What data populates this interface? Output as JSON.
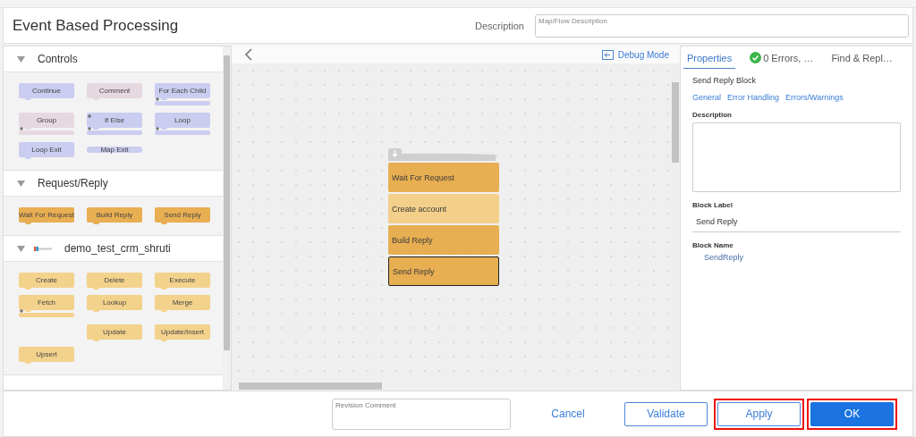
{
  "window": {
    "title": "Event Based Processing"
  },
  "description": {
    "label": "Description",
    "placeholder": "Map/Flow Description"
  },
  "palette": {
    "sections": [
      {
        "title": "Controls",
        "expanded": true,
        "icon": false,
        "blocks": [
          {
            "label": "Continue",
            "kind": "simple",
            "color": "#cacdef"
          },
          {
            "label": "Comment",
            "kind": "simple",
            "color": "#e6d8e0"
          },
          {
            "label": "For Each Child",
            "kind": "container",
            "color": "#cacdef"
          },
          {
            "label": "Group",
            "kind": "container",
            "color": "#e6d8e0"
          },
          {
            "label": "If Else",
            "kind": "double",
            "color": "#cacdef"
          },
          {
            "label": "Loop",
            "kind": "container",
            "color": "#cacdef"
          },
          {
            "label": "Loop Exit",
            "kind": "simple",
            "color": "#cacdef"
          },
          {
            "label": "Map Exit",
            "kind": "flat",
            "color": "#cacdef"
          }
        ]
      },
      {
        "title": "Request/Reply",
        "expanded": true,
        "icon": false,
        "blocks": [
          {
            "label": "Wait For Request",
            "kind": "simple",
            "color": "#e8ae52"
          },
          {
            "label": "Build Reply",
            "kind": "simple",
            "color": "#e8ae52"
          },
          {
            "label": "Send Reply",
            "kind": "simple",
            "color": "#e8ae52"
          }
        ]
      },
      {
        "title": "demo_test_crm_shruti",
        "expanded": true,
        "icon": true,
        "blocks": [
          {
            "label": "Create",
            "kind": "simple",
            "color": "#f3d28c"
          },
          {
            "label": "Delete",
            "kind": "simple",
            "color": "#f3d28c"
          },
          {
            "label": "Execute",
            "kind": "simple",
            "color": "#f3d28c"
          },
          {
            "label": "Fetch",
            "kind": "container",
            "color": "#f3d28c"
          },
          {
            "label": "Lookup",
            "kind": "simple",
            "color": "#f3d28c"
          },
          {
            "label": "Merge",
            "kind": "simple",
            "color": "#f3d28c"
          },
          {
            "kind": "spacer"
          },
          {
            "label": "Update",
            "kind": "simple",
            "color": "#f3d28c"
          },
          {
            "label": "Update/Insert",
            "kind": "simple",
            "color": "#f3d28c"
          },
          {
            "label": "Upsert",
            "kind": "simple",
            "color": "#f3d28c"
          }
        ]
      }
    ]
  },
  "canvas": {
    "debug_mode": "Debug Mode",
    "blocks": [
      {
        "label": "Wait For Request",
        "color": "#e8ae52",
        "selected": false
      },
      {
        "label": "Create account",
        "color": "#f3cf8a",
        "selected": false
      },
      {
        "label": "Build Reply",
        "color": "#e8ae52",
        "selected": false
      },
      {
        "label": "Send Reply",
        "color": "#e8ae52",
        "selected": true
      }
    ]
  },
  "properties": {
    "tabs": [
      {
        "label": "Properties",
        "selected": true,
        "kind": "plain"
      },
      {
        "label": "0 Errors, …",
        "selected": false,
        "kind": "status"
      },
      {
        "label": "Find & Repl…",
        "selected": false,
        "kind": "plain"
      }
    ],
    "heading": "Send Reply Block",
    "links": [
      "General",
      "Error Handling",
      "Errors/Warnings"
    ],
    "description_label": "Description",
    "block_label": {
      "label": "Block Label",
      "value": "Send Reply"
    },
    "block_name": {
      "label": "Block Name",
      "value": "SendReply"
    }
  },
  "footer": {
    "revision_placeholder": "Revision Comment",
    "buttons": [
      {
        "label": "Cancel",
        "kind": "link",
        "highlighted": false
      },
      {
        "label": "Validate",
        "kind": "outline",
        "highlighted": false
      },
      {
        "label": "Apply",
        "kind": "outline",
        "highlighted": true
      },
      {
        "label": "OK",
        "kind": "primary",
        "highlighted": true
      }
    ]
  }
}
